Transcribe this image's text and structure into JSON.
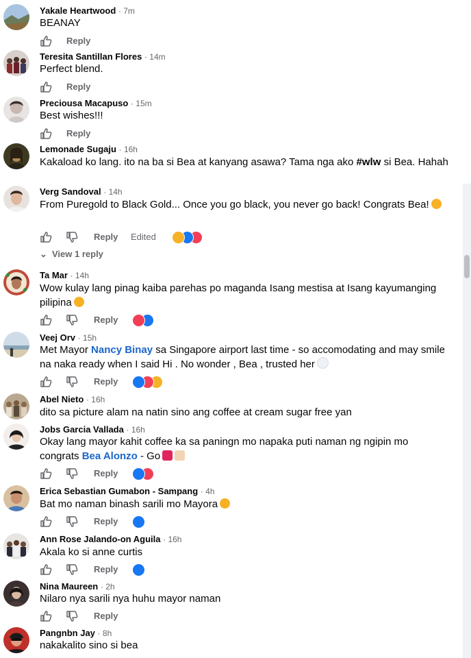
{
  "actions": {
    "reply": "Reply",
    "edited": "Edited",
    "view_replies": "View 1 reply"
  },
  "colors": {
    "link": "#1b66c9",
    "meta": "#65676b",
    "text": "#050505",
    "like": "#1877f2",
    "love": "#f33e58",
    "haha": "#f7b125"
  },
  "comments": [
    {
      "name": "Yakale Heartwood",
      "time": "7m",
      "text": "BEANAY",
      "avatar_color": "#7b8fa8"
    },
    {
      "name": "Teresita Santillan Flores",
      "time": "14m",
      "text": "Perfect blend.",
      "avatar_color": "#6a5d5e"
    },
    {
      "name": "Preciousa Macapuso",
      "time": "15m",
      "text": "Best wishes!!!",
      "avatar_color": "#c8c2c4"
    },
    {
      "name": "Lemonade Sugaju",
      "time": "16h",
      "text_before": "Kakaload ko lang. ito na ba si Bea at kanyang asawa? Tama nga ako ",
      "hashtag": "#wlw",
      "text_after": " si Bea. Hahah",
      "avatar_color": "#5a4a2e"
    },
    {
      "name": "Verg Sandoval",
      "time": "14h",
      "text": "From Puregold to Black Gold... Once you go black, you never go back! Congrats Bea!",
      "avatar_color": "#d9b7a8",
      "reactions": [
        "haha",
        "like",
        "love"
      ]
    },
    {
      "name": "Ta Mar",
      "time": "14h",
      "text": "Wow kulay lang pinag kaiba parehas po maganda Isang mestisa at Isang kayumanging pilipina",
      "avatar_color": "#8a5a4a",
      "reactions": [
        "love",
        "like"
      ]
    },
    {
      "name": "Veej Orv",
      "time": "15h",
      "text_before": "Met Mayor ",
      "mention": "Nancy Binay",
      "text_after": " sa Singapore airport last time - so accomodating and may smile na naka ready when I said Hi . No wonder , Bea , trusted her",
      "avatar_color": "#9fb0c0",
      "reactions": [
        "like",
        "love",
        "care"
      ]
    },
    {
      "name": "Abel Nieto",
      "time": "16h",
      "text": "dito sa picture alam na natin sino ang coffee at cream sugar free yan",
      "avatar_color": "#a89070"
    },
    {
      "name": "Jobs Garcia Vallada",
      "time": "16h",
      "text_before": "Okay lang mayor kahit coffee ka sa paningn mo napaka puti naman ng ngipin mo congrats ",
      "mention": "Bea Alonzo",
      "text_after": " - Go",
      "avatar_color": "#e2d6d0",
      "reactions": [
        "like",
        "love"
      ]
    },
    {
      "name": "Erica Sebastian Gumabon - Sampang",
      "time": "4h",
      "text": "Bat mo naman binash sarili mo Mayora",
      "avatar_color": "#c79a70",
      "reactions": [
        "like"
      ]
    },
    {
      "name": "Ann Rose Jalando-on Aguila",
      "time": "16h",
      "text": "Akala ko si anne curtis",
      "avatar_color": "#9a8578",
      "reactions": [
        "like"
      ]
    },
    {
      "name": "Nina Maureen",
      "time": "2h",
      "text": "Nilaro nya sarili nya huhu mayor naman",
      "avatar_color": "#5a4848"
    },
    {
      "name": "Pangnbn Jay",
      "time": "8h",
      "text": "nakakalito sino si bea",
      "avatar_color": "#b03a3a"
    }
  ]
}
